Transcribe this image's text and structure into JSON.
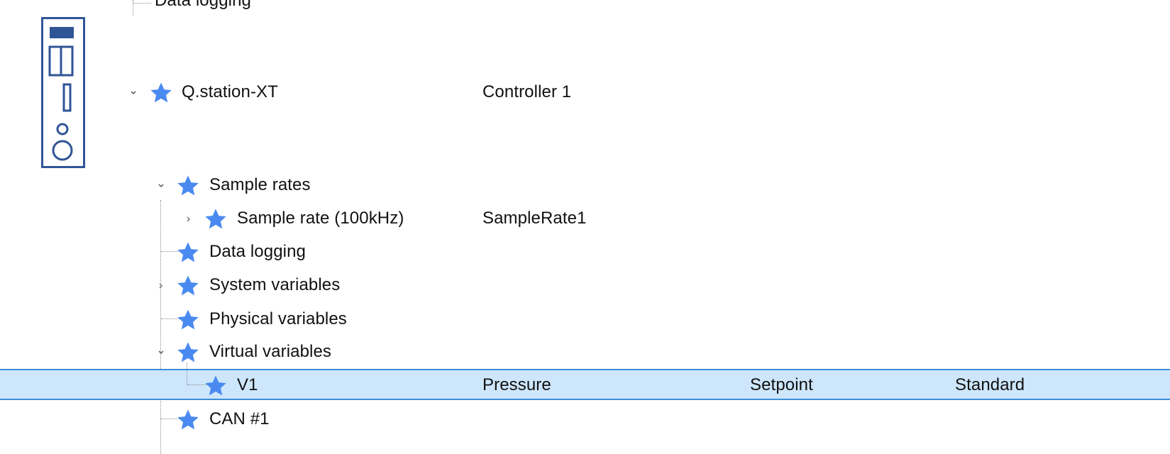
{
  "colors": {
    "star": "#4a8af0",
    "selection_bg": "#cde6fb",
    "selection_border": "#3b8fd9",
    "device_icon": "#2f5597",
    "text": "#111111",
    "tree_lines": "#8a8a8a"
  },
  "icons": {
    "node": "star-icon",
    "device": "controller-device-icon",
    "expanded": "chevron-down-icon",
    "collapsed": "chevron-right-icon"
  },
  "tree": {
    "top_partial": {
      "label": "Data logging"
    },
    "device": {
      "label": "Q.station-XT",
      "value": "Controller 1",
      "expanded": true
    },
    "nodes": {
      "sample_rates": {
        "label": "Sample rates",
        "expanded": true
      },
      "sample_rate_100k": {
        "label": "Sample rate (100kHz)",
        "value": "SampleRate1",
        "expanded": false
      },
      "data_logging": {
        "label": "Data logging"
      },
      "system_variables": {
        "label": "System variables",
        "expanded": false
      },
      "physical_variables": {
        "label": "Physical variables"
      },
      "virtual_variables": {
        "label": "Virtual variables",
        "expanded": true
      },
      "v1": {
        "label": "V1",
        "col1": "Pressure",
        "col2": "Setpoint",
        "col3": "Standard",
        "selected": true
      },
      "can1": {
        "label": "CAN #1"
      }
    }
  }
}
